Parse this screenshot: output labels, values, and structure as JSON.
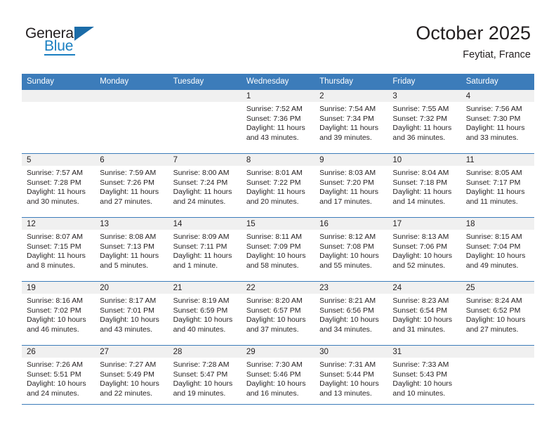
{
  "brand": {
    "name_top": "General",
    "name_bottom": "Blue",
    "accent_color": "#1b6ca8"
  },
  "header": {
    "title": "October 2025",
    "location": "Feytiat, France"
  },
  "calendar": {
    "header_bg": "#3c7cba",
    "daynum_bg": "#f0f0f0",
    "weekday_names": [
      "Sunday",
      "Monday",
      "Tuesday",
      "Wednesday",
      "Thursday",
      "Friday",
      "Saturday"
    ],
    "weeks": [
      [
        {
          "day": "",
          "empty": true
        },
        {
          "day": "",
          "empty": true
        },
        {
          "day": "",
          "empty": true
        },
        {
          "day": "1",
          "sunrise": "Sunrise: 7:52 AM",
          "sunset": "Sunset: 7:36 PM",
          "daylight1": "Daylight: 11 hours",
          "daylight2": "and 43 minutes."
        },
        {
          "day": "2",
          "sunrise": "Sunrise: 7:54 AM",
          "sunset": "Sunset: 7:34 PM",
          "daylight1": "Daylight: 11 hours",
          "daylight2": "and 39 minutes."
        },
        {
          "day": "3",
          "sunrise": "Sunrise: 7:55 AM",
          "sunset": "Sunset: 7:32 PM",
          "daylight1": "Daylight: 11 hours",
          "daylight2": "and 36 minutes."
        },
        {
          "day": "4",
          "sunrise": "Sunrise: 7:56 AM",
          "sunset": "Sunset: 7:30 PM",
          "daylight1": "Daylight: 11 hours",
          "daylight2": "and 33 minutes."
        }
      ],
      [
        {
          "day": "5",
          "sunrise": "Sunrise: 7:57 AM",
          "sunset": "Sunset: 7:28 PM",
          "daylight1": "Daylight: 11 hours",
          "daylight2": "and 30 minutes."
        },
        {
          "day": "6",
          "sunrise": "Sunrise: 7:59 AM",
          "sunset": "Sunset: 7:26 PM",
          "daylight1": "Daylight: 11 hours",
          "daylight2": "and 27 minutes."
        },
        {
          "day": "7",
          "sunrise": "Sunrise: 8:00 AM",
          "sunset": "Sunset: 7:24 PM",
          "daylight1": "Daylight: 11 hours",
          "daylight2": "and 24 minutes."
        },
        {
          "day": "8",
          "sunrise": "Sunrise: 8:01 AM",
          "sunset": "Sunset: 7:22 PM",
          "daylight1": "Daylight: 11 hours",
          "daylight2": "and 20 minutes."
        },
        {
          "day": "9",
          "sunrise": "Sunrise: 8:03 AM",
          "sunset": "Sunset: 7:20 PM",
          "daylight1": "Daylight: 11 hours",
          "daylight2": "and 17 minutes."
        },
        {
          "day": "10",
          "sunrise": "Sunrise: 8:04 AM",
          "sunset": "Sunset: 7:18 PM",
          "daylight1": "Daylight: 11 hours",
          "daylight2": "and 14 minutes."
        },
        {
          "day": "11",
          "sunrise": "Sunrise: 8:05 AM",
          "sunset": "Sunset: 7:17 PM",
          "daylight1": "Daylight: 11 hours",
          "daylight2": "and 11 minutes."
        }
      ],
      [
        {
          "day": "12",
          "sunrise": "Sunrise: 8:07 AM",
          "sunset": "Sunset: 7:15 PM",
          "daylight1": "Daylight: 11 hours",
          "daylight2": "and 8 minutes."
        },
        {
          "day": "13",
          "sunrise": "Sunrise: 8:08 AM",
          "sunset": "Sunset: 7:13 PM",
          "daylight1": "Daylight: 11 hours",
          "daylight2": "and 5 minutes."
        },
        {
          "day": "14",
          "sunrise": "Sunrise: 8:09 AM",
          "sunset": "Sunset: 7:11 PM",
          "daylight1": "Daylight: 11 hours",
          "daylight2": "and 1 minute."
        },
        {
          "day": "15",
          "sunrise": "Sunrise: 8:11 AM",
          "sunset": "Sunset: 7:09 PM",
          "daylight1": "Daylight: 10 hours",
          "daylight2": "and 58 minutes."
        },
        {
          "day": "16",
          "sunrise": "Sunrise: 8:12 AM",
          "sunset": "Sunset: 7:08 PM",
          "daylight1": "Daylight: 10 hours",
          "daylight2": "and 55 minutes."
        },
        {
          "day": "17",
          "sunrise": "Sunrise: 8:13 AM",
          "sunset": "Sunset: 7:06 PM",
          "daylight1": "Daylight: 10 hours",
          "daylight2": "and 52 minutes."
        },
        {
          "day": "18",
          "sunrise": "Sunrise: 8:15 AM",
          "sunset": "Sunset: 7:04 PM",
          "daylight1": "Daylight: 10 hours",
          "daylight2": "and 49 minutes."
        }
      ],
      [
        {
          "day": "19",
          "sunrise": "Sunrise: 8:16 AM",
          "sunset": "Sunset: 7:02 PM",
          "daylight1": "Daylight: 10 hours",
          "daylight2": "and 46 minutes."
        },
        {
          "day": "20",
          "sunrise": "Sunrise: 8:17 AM",
          "sunset": "Sunset: 7:01 PM",
          "daylight1": "Daylight: 10 hours",
          "daylight2": "and 43 minutes."
        },
        {
          "day": "21",
          "sunrise": "Sunrise: 8:19 AM",
          "sunset": "Sunset: 6:59 PM",
          "daylight1": "Daylight: 10 hours",
          "daylight2": "and 40 minutes."
        },
        {
          "day": "22",
          "sunrise": "Sunrise: 8:20 AM",
          "sunset": "Sunset: 6:57 PM",
          "daylight1": "Daylight: 10 hours",
          "daylight2": "and 37 minutes."
        },
        {
          "day": "23",
          "sunrise": "Sunrise: 8:21 AM",
          "sunset": "Sunset: 6:56 PM",
          "daylight1": "Daylight: 10 hours",
          "daylight2": "and 34 minutes."
        },
        {
          "day": "24",
          "sunrise": "Sunrise: 8:23 AM",
          "sunset": "Sunset: 6:54 PM",
          "daylight1": "Daylight: 10 hours",
          "daylight2": "and 31 minutes."
        },
        {
          "day": "25",
          "sunrise": "Sunrise: 8:24 AM",
          "sunset": "Sunset: 6:52 PM",
          "daylight1": "Daylight: 10 hours",
          "daylight2": "and 27 minutes."
        }
      ],
      [
        {
          "day": "26",
          "sunrise": "Sunrise: 7:26 AM",
          "sunset": "Sunset: 5:51 PM",
          "daylight1": "Daylight: 10 hours",
          "daylight2": "and 24 minutes."
        },
        {
          "day": "27",
          "sunrise": "Sunrise: 7:27 AM",
          "sunset": "Sunset: 5:49 PM",
          "daylight1": "Daylight: 10 hours",
          "daylight2": "and 22 minutes."
        },
        {
          "day": "28",
          "sunrise": "Sunrise: 7:28 AM",
          "sunset": "Sunset: 5:47 PM",
          "daylight1": "Daylight: 10 hours",
          "daylight2": "and 19 minutes."
        },
        {
          "day": "29",
          "sunrise": "Sunrise: 7:30 AM",
          "sunset": "Sunset: 5:46 PM",
          "daylight1": "Daylight: 10 hours",
          "daylight2": "and 16 minutes."
        },
        {
          "day": "30",
          "sunrise": "Sunrise: 7:31 AM",
          "sunset": "Sunset: 5:44 PM",
          "daylight1": "Daylight: 10 hours",
          "daylight2": "and 13 minutes."
        },
        {
          "day": "31",
          "sunrise": "Sunrise: 7:33 AM",
          "sunset": "Sunset: 5:43 PM",
          "daylight1": "Daylight: 10 hours",
          "daylight2": "and 10 minutes."
        },
        {
          "day": "",
          "empty": true
        }
      ]
    ]
  }
}
